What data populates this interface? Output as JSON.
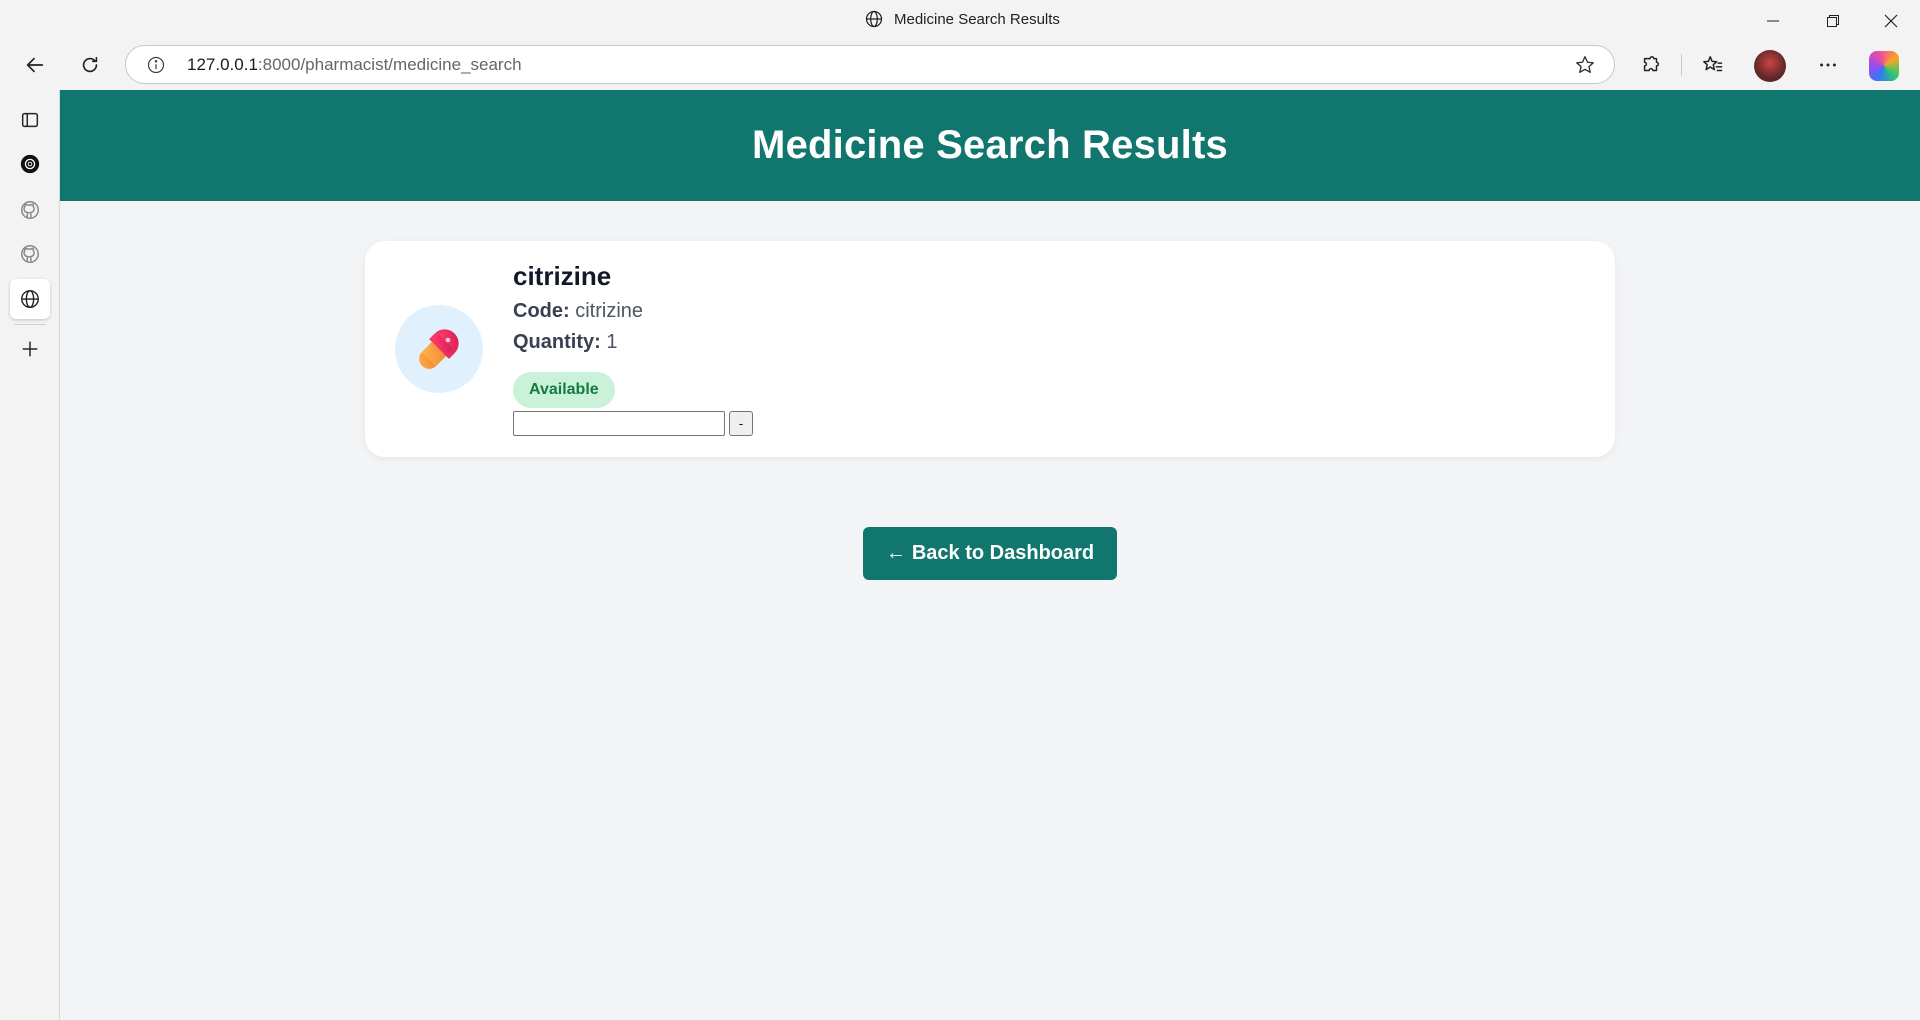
{
  "window": {
    "title": "Medicine Search Results"
  },
  "address_bar": {
    "host": "127.0.0.1",
    "path": ":8000/pharmacist/medicine_search"
  },
  "page": {
    "heading": "Medicine Search Results",
    "results": [
      {
        "name": "citrizine",
        "code_label": "Code:",
        "code": "citrizine",
        "quantity_label": "Quantity:",
        "quantity": "1",
        "status": "Available",
        "input_value": "",
        "minus_label": "-"
      }
    ],
    "back_button": {
      "arrow": "←",
      "label": "Back to Dashboard"
    }
  },
  "colors": {
    "header_bg": "#11766e",
    "badge_bg": "#c9f2d8",
    "badge_text": "#157a3f",
    "page_bg": "#f3f4f6"
  },
  "icons": {
    "tab_globe": "globe-icon",
    "back": "back-arrow-icon",
    "reload": "reload-icon",
    "info": "info-icon",
    "favorite": "star-icon",
    "extensions": "puzzle-icon",
    "favorites_list": "favorites-icon",
    "more": "more-icon",
    "copilot": "copilot-icon",
    "medicine": "pill-icon"
  }
}
